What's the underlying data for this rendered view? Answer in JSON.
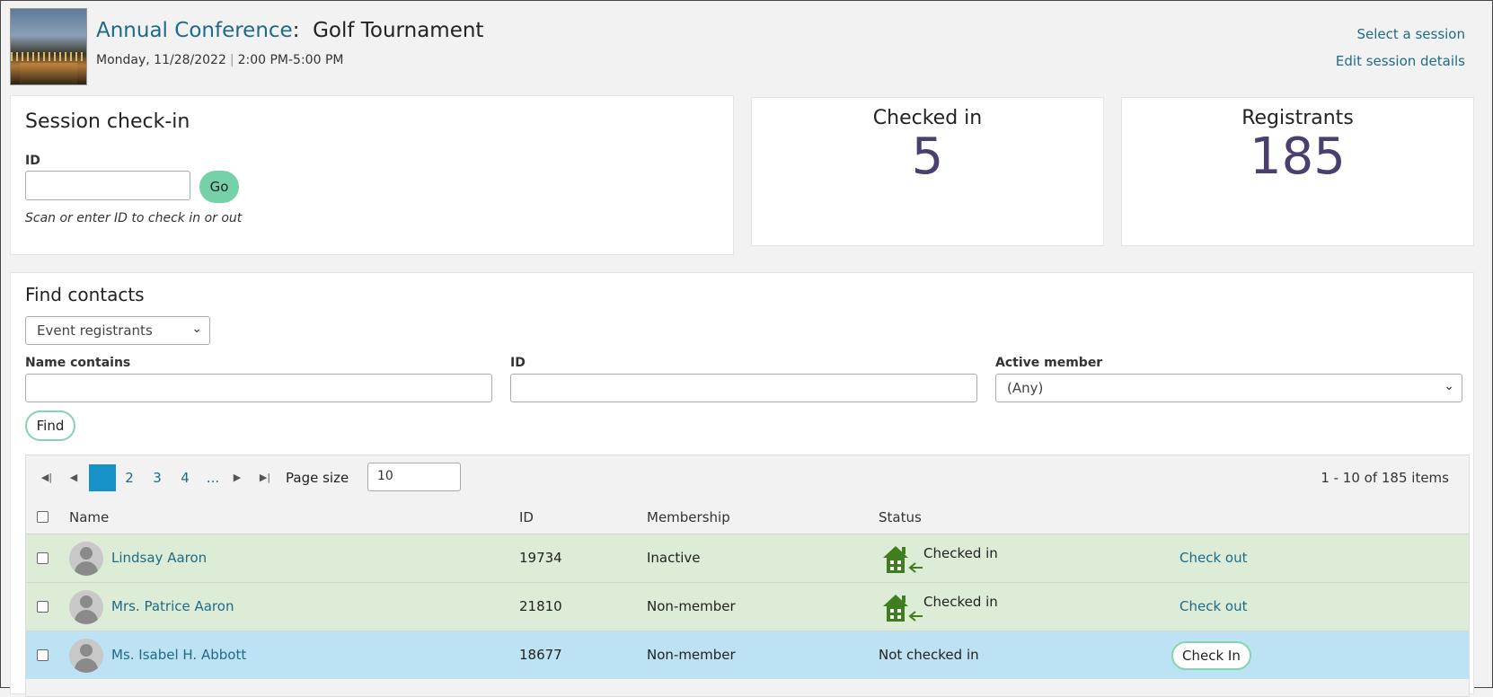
{
  "header": {
    "conference": "Annual Conference",
    "separator": ":",
    "session": "Golf Tournament",
    "date": "Monday, 11/28/2022",
    "time": "2:00 PM-5:00 PM",
    "select_session": "Select a session",
    "edit_session": "Edit session details"
  },
  "checkin": {
    "title": "Session check-in",
    "id_label": "ID",
    "id_value": "",
    "go_label": "Go",
    "hint": "Scan or enter ID to check in or out"
  },
  "stats": {
    "checked_in_label": "Checked in",
    "checked_in_value": "5",
    "registrants_label": "Registrants",
    "registrants_value": "185"
  },
  "find": {
    "title": "Find contacts",
    "source_select": "Event registrants",
    "name_label": "Name contains",
    "name_value": "",
    "id_label": "ID",
    "id_value": "",
    "active_label": "Active member",
    "active_select": "(Any)",
    "find_label": "Find"
  },
  "pager": {
    "first_icon": "first-page-icon",
    "prev_icon": "prev-page-icon",
    "pages": [
      "1",
      "2",
      "3",
      "4",
      "..."
    ],
    "active_page": "1",
    "next_icon": "next-page-icon",
    "last_icon": "last-page-icon",
    "page_size_label": "Page size",
    "page_size": "10",
    "items_info": "1 - 10 of 185 items"
  },
  "table": {
    "columns": [
      "Name",
      "ID",
      "Membership",
      "Status"
    ],
    "rows": [
      {
        "name": "Lindsay Aaron",
        "id": "19734",
        "membership": "Inactive",
        "status": "Checked in",
        "action": "Check out",
        "state": "in"
      },
      {
        "name": "Mrs. Patrice Aaron",
        "id": "21810",
        "membership": "Non-member",
        "status": "Checked in",
        "action": "Check out",
        "state": "in"
      },
      {
        "name": "Ms. Isabel H. Abbott",
        "id": "18677",
        "membership": "Non-member",
        "status": "Not checked in",
        "action": "Check In",
        "state": "out"
      }
    ]
  },
  "colors": {
    "link": "#1f6a87",
    "accent_green": "#76d0a8",
    "stat_number": "#4a3f6e",
    "row_checked_in": "#dcecd6",
    "row_selected": "#bde2f3",
    "house_icon": "#3f7d1e",
    "pager_active": "#1692c8"
  }
}
